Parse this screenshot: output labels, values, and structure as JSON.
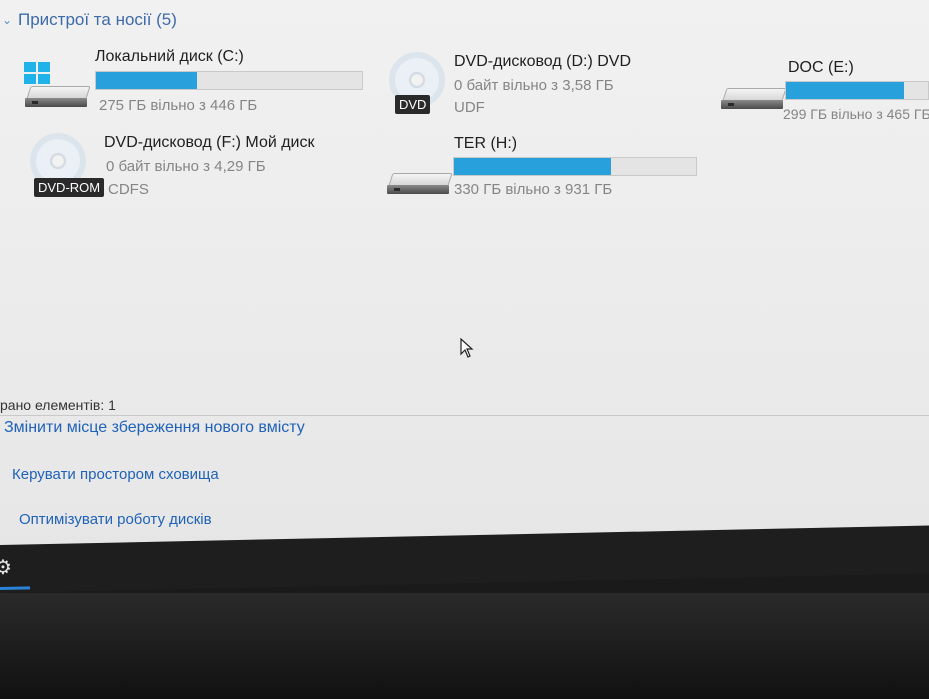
{
  "group": {
    "title": "Пристрої та носії (5)"
  },
  "drives": [
    {
      "name": "Локальний диск (C:)",
      "sub": "275 ГБ вільно з 446 ГБ",
      "used_fraction": 0.38
    },
    {
      "name": "DVD-дисковод (D:) DVD",
      "sub1": "0 байт вільно з 3,58 ГБ",
      "sub2": "UDF",
      "badge": "DVD"
    },
    {
      "name": "DOC (E:)",
      "sub": "299 ГБ вільно з 465 ГБ",
      "used_fraction": 0.36
    },
    {
      "name": "DVD-дисковод (F:) Мой диск",
      "sub1": "0 байт вільно з 4,29 ГБ",
      "sub2": "CDFS",
      "badge": "DVD-ROM"
    },
    {
      "name": "TER (H:)",
      "sub": "330 ГБ вільно з 931 ГБ",
      "used_fraction": 0.65
    }
  ],
  "status": {
    "text": "рано елементів: 1"
  },
  "links": [
    {
      "label": "Змінити місце збереження нового вмісту"
    },
    {
      "label": "Керувати простором сховища"
    },
    {
      "label": "Оптимізувати роботу дисків"
    }
  ],
  "colors": {
    "bar_fill": "#27a0dc",
    "link": "#1f62b8",
    "header": "#3d6aa8"
  },
  "icons": [
    "chevron-down-icon",
    "windows-logo-icon",
    "hard-drive-icon",
    "dvd-disc-icon",
    "gear-icon",
    "mouse-cursor-icon"
  ]
}
